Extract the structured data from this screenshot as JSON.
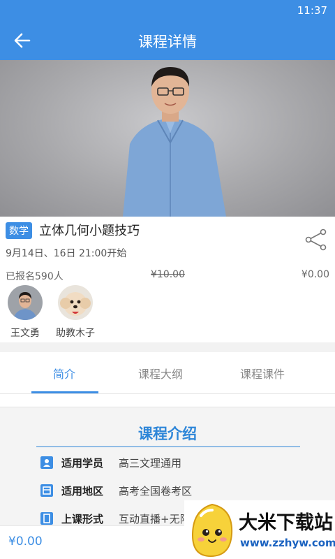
{
  "status_bar": {
    "time": "11:37"
  },
  "appbar": {
    "title": "课程详情"
  },
  "course": {
    "subject": "数学",
    "title": "立体几何小题技巧",
    "schedule": "9月14日、16日 21:00开始",
    "enrolled": "已报名590人",
    "original_price": "¥10.00",
    "price": "¥0.00"
  },
  "teachers": [
    {
      "name": "王文勇"
    },
    {
      "name": "助教木子"
    }
  ],
  "tabs": [
    {
      "label": "简介",
      "active": true
    },
    {
      "label": "课程大纲",
      "active": false
    },
    {
      "label": "课程课件",
      "active": false
    }
  ],
  "intro": {
    "title": "课程介绍",
    "rows": [
      {
        "label": "适用学员",
        "value": "高三文理通用"
      },
      {
        "label": "适用地区",
        "value": "高考全国卷考区"
      },
      {
        "label": "上课形式",
        "value": "互动直播+无限"
      }
    ]
  },
  "bottom": {
    "price": "¥0.00"
  },
  "watermark": {
    "name": "大米下载站",
    "url": "www.zzhyw.com"
  },
  "colors": {
    "primary": "#3d8ee4",
    "intro_accent": "#2e86d8"
  }
}
